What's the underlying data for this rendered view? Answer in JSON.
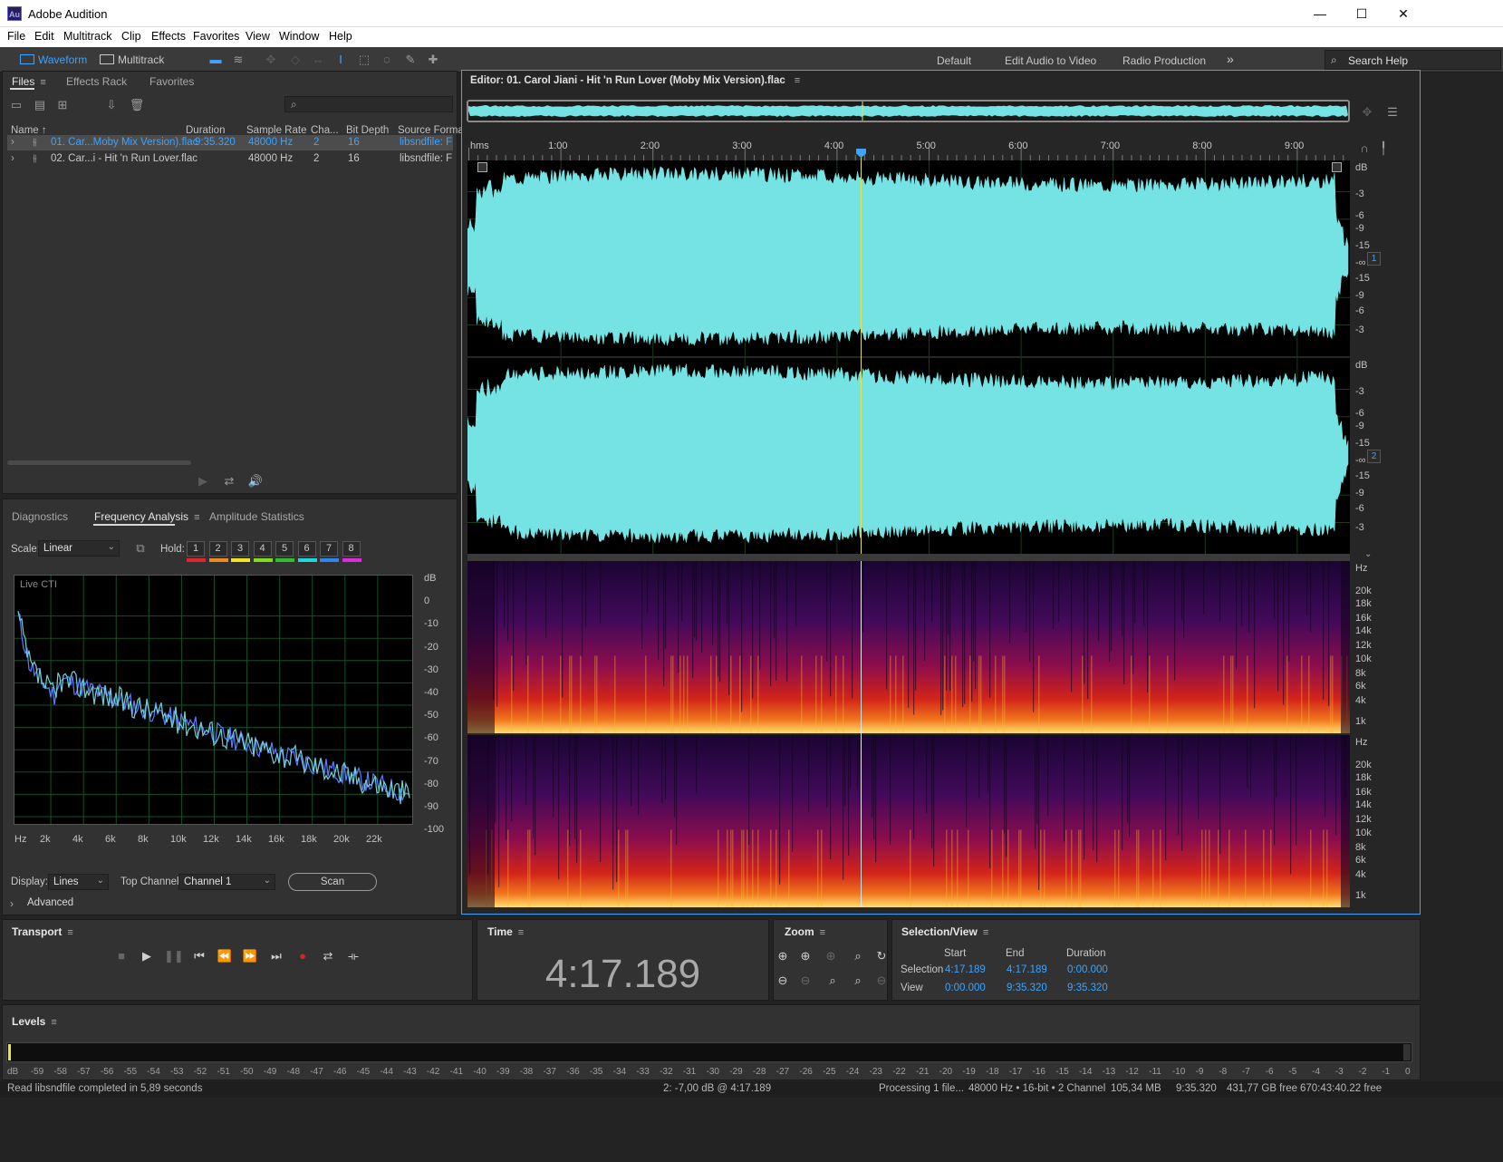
{
  "window": {
    "app_icon": "Au",
    "title": "Adobe Audition",
    "min": "—",
    "max": "☐",
    "close": "✕"
  },
  "menu": [
    "File",
    "Edit",
    "Multitrack",
    "Clip",
    "Effects",
    "Favorites",
    "View",
    "Window",
    "Help"
  ],
  "toolbar": {
    "waveform_label": "Waveform",
    "multitrack_label": "Multitrack",
    "workspaces": [
      "Default",
      "Edit Audio to Video",
      "Radio Production"
    ],
    "more": "»",
    "search_placeholder": "Search Help"
  },
  "files": {
    "tabs": [
      "Files",
      "Effects Rack",
      "Favorites"
    ],
    "columns": [
      "Name ↑",
      "Duration",
      "Sample Rate",
      "Cha...",
      "Bit Depth",
      "Source Forma"
    ],
    "rows": [
      {
        "name": "01. Car...Moby Mix Version).flac",
        "duration": "9:35.320",
        "rate": "48000 Hz",
        "ch": "2",
        "bits": "16",
        "format": "libsndfile: FL"
      },
      {
        "name": "02. Car...i - Hit 'n Run Lover.flac",
        "duration": "",
        "rate": "48000 Hz",
        "ch": "2",
        "bits": "16",
        "format": "libsndfile: FL"
      }
    ]
  },
  "analysis": {
    "tabs": [
      "Diagnostics",
      "Frequency Analysis",
      "Amplitude Statistics"
    ],
    "scale_label": "Scale:",
    "scale_value": "Linear",
    "hold_label": "Hold:",
    "hold_buttons": [
      "1",
      "2",
      "3",
      "4",
      "5",
      "6",
      "7",
      "8"
    ],
    "hold_colors": [
      "#e0262a",
      "#f08a1e",
      "#f2e51e",
      "#7fdc1e",
      "#2fbf2f",
      "#1fd7e0",
      "#2a86f0",
      "#e02ae0"
    ],
    "live_label": "Live CTI",
    "db_ticks": [
      "dB",
      "0",
      "-10",
      "-20",
      "-30",
      "-40",
      "-50",
      "-60",
      "-70",
      "-80",
      "-90",
      "-100"
    ],
    "hz_ticks": [
      "Hz",
      "2k",
      "4k",
      "6k",
      "8k",
      "10k",
      "12k",
      "14k",
      "16k",
      "18k",
      "20k",
      "22k"
    ],
    "display_label": "Display:",
    "display_value": "Lines",
    "top_channel_label": "Top Channel:",
    "top_channel_value": "Channel 1",
    "scan_label": "Scan",
    "advanced_label": "Advanced"
  },
  "editor": {
    "title": "Editor: 01. Carol Jiani - Hit 'n Run Lover (Moby Mix Version).flac",
    "ruler": [
      "hms",
      "1:00",
      "2:00",
      "3:00",
      "4:00",
      "5:00",
      "6:00",
      "7:00",
      "8:00",
      "9:00"
    ],
    "wave_db": [
      "dB",
      "-3",
      "-6",
      "-9",
      "-15",
      "-∞",
      "-15",
      "-9",
      "-6",
      "-3"
    ],
    "spec_hz": [
      "Hz",
      "20k",
      "18k",
      "16k",
      "14k",
      "12k",
      "10k",
      "8k",
      "6k",
      "4k",
      "1k"
    ],
    "channels": [
      "1",
      "2"
    ],
    "wave_color": "#75e3e3"
  },
  "transport": {
    "label": "Transport"
  },
  "time": {
    "label": "Time",
    "value": "4:17.189"
  },
  "zoom": {
    "label": "Zoom"
  },
  "selection": {
    "label": "Selection/View",
    "headers": [
      "Start",
      "End",
      "Duration"
    ],
    "rows": [
      {
        "label": "Selection",
        "start": "4:17.189",
        "end": "4:17.189",
        "duration": "0:00.000"
      },
      {
        "label": "View",
        "start": "0:00.000",
        "end": "9:35.320",
        "duration": "9:35.320"
      }
    ]
  },
  "levels": {
    "label": "Levels",
    "scale": [
      "dB",
      "-59",
      "-58",
      "-57",
      "-56",
      "-55",
      "-54",
      "-53",
      "-52",
      "-51",
      "-50",
      "-49",
      "-48",
      "-47",
      "-46",
      "-45",
      "-44",
      "-43",
      "-42",
      "-41",
      "-40",
      "-39",
      "-38",
      "-37",
      "-36",
      "-35",
      "-34",
      "-33",
      "-32",
      "-31",
      "-30",
      "-29",
      "-28",
      "-27",
      "-26",
      "-25",
      "-24",
      "-23",
      "-22",
      "-21",
      "-20",
      "-19",
      "-18",
      "-17",
      "-16",
      "-15",
      "-14",
      "-13",
      "-12",
      "-11",
      "-10",
      "-9",
      "-8",
      "-7",
      "-6",
      "-5",
      "-4",
      "-3",
      "-2",
      "-1",
      "0"
    ]
  },
  "status": {
    "left": "Read libsndfile completed in 5,89 seconds",
    "cursor": "2: -7,00 dB @ 4:17.189",
    "processing": "Processing 1 file...",
    "format": "48000 Hz • 16-bit • 2 Channel",
    "size": "105,34 MB",
    "duration": "9:35.320",
    "free": "431,77 GB free",
    "free_time": "670:43:40.22 free"
  }
}
